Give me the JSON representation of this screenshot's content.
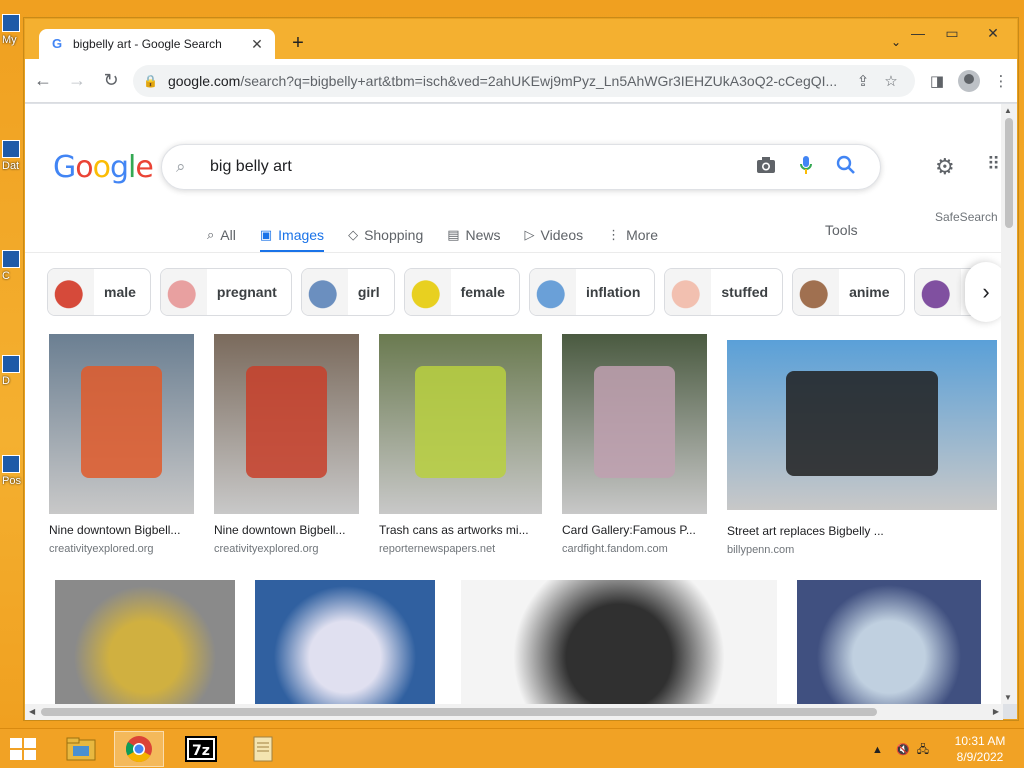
{
  "desktop": {
    "icons": [
      {
        "label": "My"
      },
      {
        "label": "Dat"
      },
      {
        "label": "C"
      },
      {
        "label": "D"
      },
      {
        "label": "Pos"
      }
    ]
  },
  "browser": {
    "tab": {
      "title": "bigbelly art - Google Search",
      "favicon": "G"
    },
    "new_tab": "+",
    "address": {
      "host": "google.com",
      "path": "/search?q=bigbelly+art&tbm=isch&ved=2ahUKEwj9mPyz_Ln5AhWGr3IEHZUkA3oQ2-cCegQI..."
    }
  },
  "google": {
    "logo": [
      "G",
      "o",
      "o",
      "g",
      "l",
      "e"
    ],
    "query": "big belly art",
    "safesearch": "SafeSearch",
    "tools": "Tools",
    "tabs": [
      {
        "label": "All",
        "icon": "⌕",
        "icon_name": "search-icon",
        "active": false
      },
      {
        "label": "Images",
        "icon": "▣",
        "icon_name": "image-icon",
        "active": true
      },
      {
        "label": "Shopping",
        "icon": "◇",
        "icon_name": "tag-icon",
        "active": false
      },
      {
        "label": "News",
        "icon": "▤",
        "icon_name": "news-icon",
        "active": false
      },
      {
        "label": "Videos",
        "icon": "▷",
        "icon_name": "video-icon",
        "active": false
      },
      {
        "label": "More",
        "icon": "⋮",
        "icon_name": "more-icon",
        "active": false
      }
    ],
    "chips": [
      {
        "label": "male",
        "color": "#d64a3a"
      },
      {
        "label": "pregnant",
        "color": "#e8a0a0"
      },
      {
        "label": "girl",
        "color": "#6b8fbf"
      },
      {
        "label": "female",
        "color": "#e8d020"
      },
      {
        "label": "inflation",
        "color": "#6aa0d8"
      },
      {
        "label": "stuffed",
        "color": "#f2c0b0"
      },
      {
        "label": "anime",
        "color": "#a07050"
      },
      {
        "label": "",
        "color": "#8050a0"
      }
    ],
    "results_row1": [
      {
        "caption": "Nine downtown Bigbell...",
        "source": "creativityexplored.org",
        "bg": "#6b7f92",
        "accent": "#e05a2a"
      },
      {
        "caption": "Nine downtown Bigbell...",
        "source": "creativityexplored.org",
        "bg": "#7a6a5c",
        "accent": "#c8402a"
      },
      {
        "caption": "Trash cans as artworks mi...",
        "source": "reporternewspapers.net",
        "bg": "#6a7a50",
        "accent": "#b8d040"
      },
      {
        "caption": "Card Gallery:Famous P...",
        "source": "cardfight.fandom.com",
        "bg": "#4a5a40",
        "accent": "#c0a0b0"
      },
      {
        "caption": "Street art replaces Bigbelly ...",
        "source": "billypenn.com",
        "bg": "#5aa0d8",
        "accent": "#202020"
      }
    ],
    "results_row2": [
      {
        "bg": "#8a8a8a",
        "accent": "#d0b040"
      },
      {
        "bg": "#3060a0",
        "accent": "#e0e0f0"
      },
      {
        "bg": "#f4f4f4",
        "accent": "#303030"
      },
      {
        "bg": "#405080",
        "accent": "#c0d0e0"
      }
    ]
  },
  "taskbar": {
    "apps": [
      {
        "name": "file-explorer",
        "glyph": "📁"
      },
      {
        "name": "chrome",
        "glyph": "◉"
      },
      {
        "name": "7zip",
        "glyph": "7z"
      },
      {
        "name": "notepad",
        "glyph": "▤"
      }
    ],
    "time": "10:31 AM",
    "date": "8/9/2022"
  }
}
